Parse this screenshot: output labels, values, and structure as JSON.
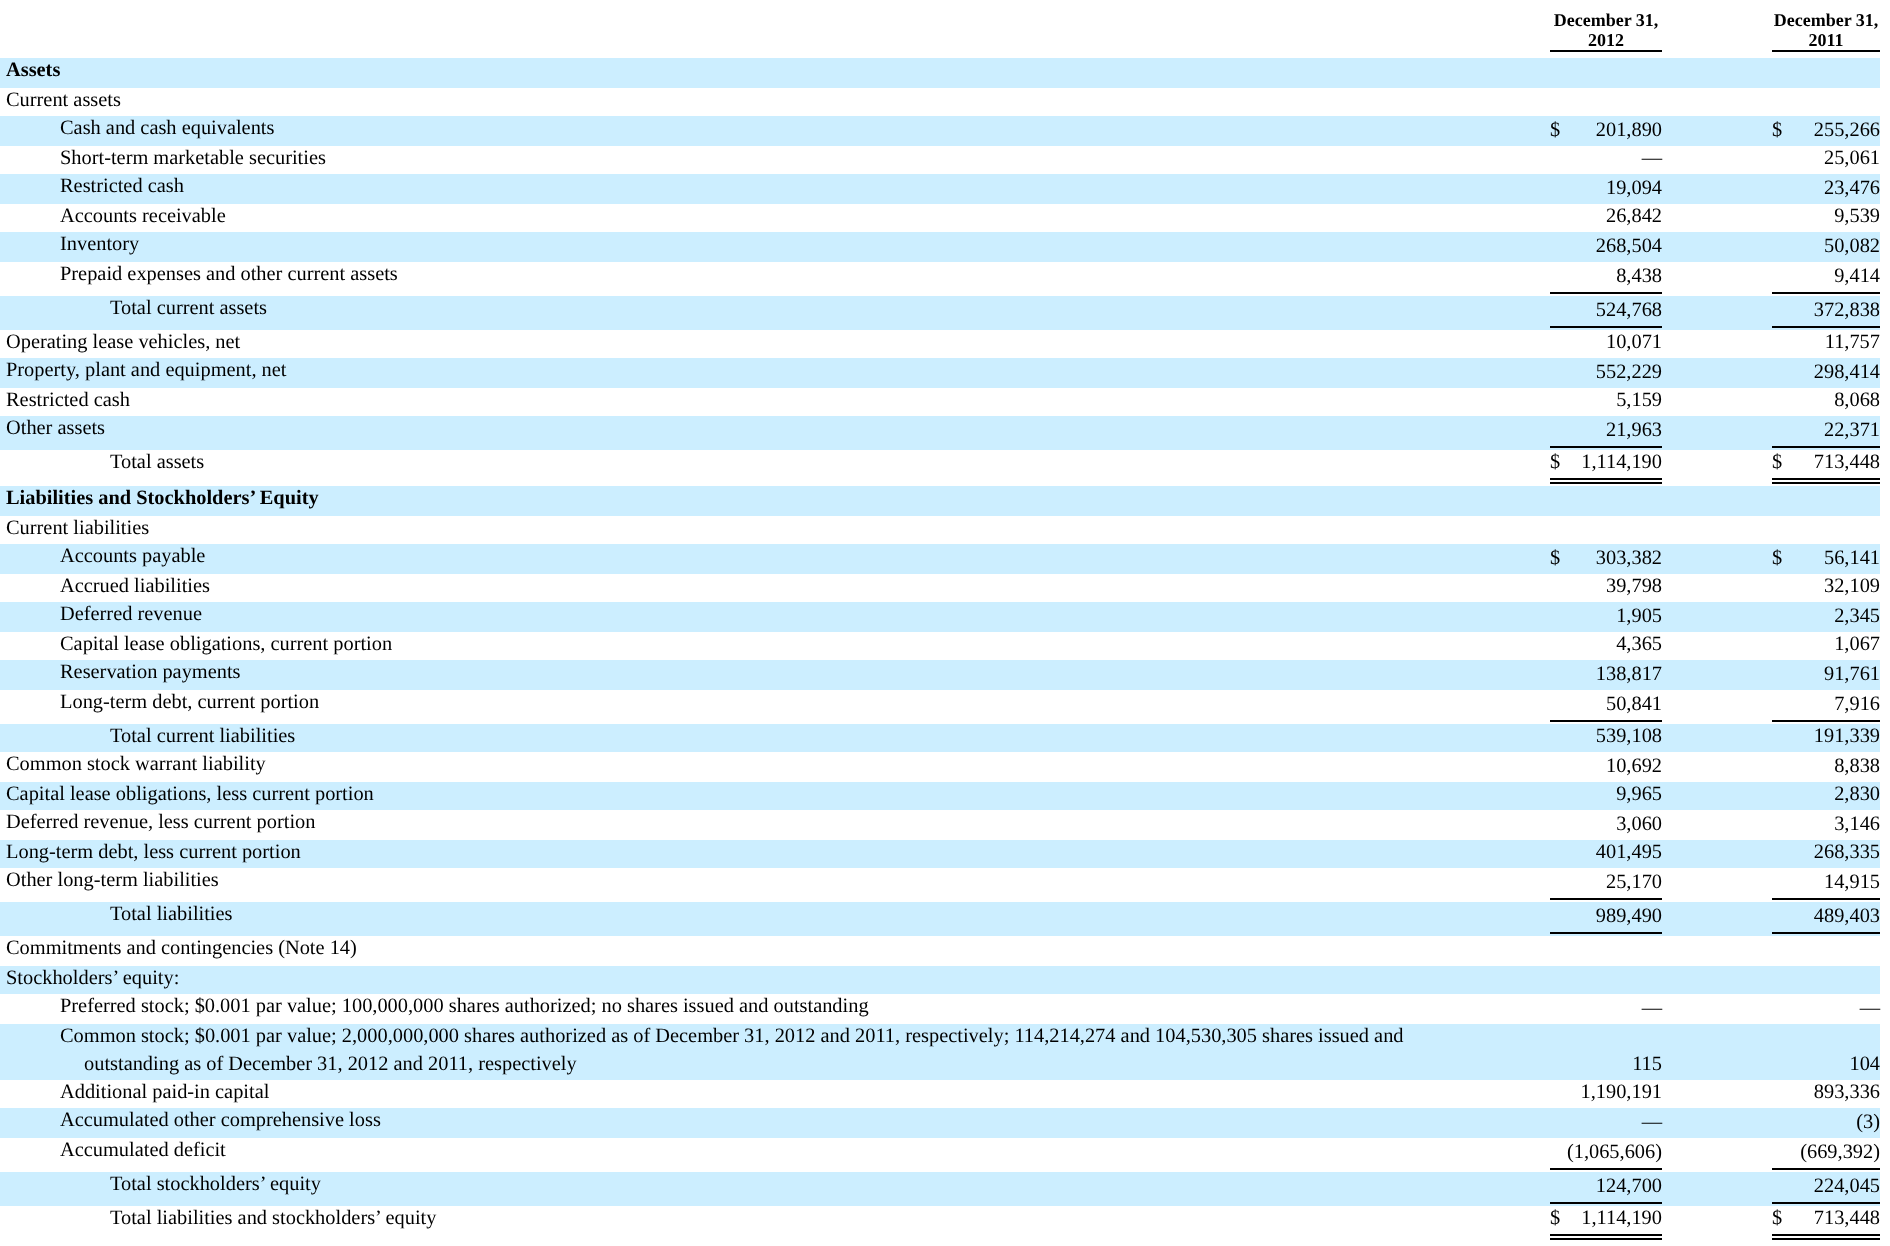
{
  "columns": [
    {
      "heading": "December 31,",
      "year": "2012"
    },
    {
      "heading": "December 31,",
      "year": "2011"
    }
  ],
  "rows": [
    {
      "kind": "section",
      "label": "Assets"
    },
    {
      "kind": "group",
      "label": "Current assets"
    },
    {
      "kind": "item",
      "label": "Cash and cash equivalents",
      "values": [
        {
          "currency": "$",
          "amount": "201,890"
        },
        {
          "currency": "$",
          "amount": "255,266"
        }
      ]
    },
    {
      "kind": "item",
      "label": "Short-term marketable securities",
      "values": [
        {
          "amount": "—"
        },
        {
          "amount": "25,061"
        }
      ]
    },
    {
      "kind": "item",
      "label": "Restricted cash",
      "values": [
        {
          "amount": "19,094"
        },
        {
          "amount": "23,476"
        }
      ]
    },
    {
      "kind": "item",
      "label": "Accounts receivable",
      "values": [
        {
          "amount": "26,842"
        },
        {
          "amount": "9,539"
        }
      ]
    },
    {
      "kind": "item",
      "label": "Inventory",
      "values": [
        {
          "amount": "268,504"
        },
        {
          "amount": "50,082"
        }
      ]
    },
    {
      "kind": "item",
      "label": "Prepaid expenses and other current assets",
      "values": [
        {
          "amount": "8,438",
          "underline": true
        },
        {
          "amount": "9,414",
          "underline": true
        }
      ]
    },
    {
      "kind": "total",
      "label": "Total current assets",
      "values": [
        {
          "amount": "524,768",
          "underline": true
        },
        {
          "amount": "372,838",
          "underline": true
        }
      ]
    },
    {
      "kind": "group",
      "label": "Operating lease vehicles, net",
      "values": [
        {
          "amount": "10,071"
        },
        {
          "amount": "11,757"
        }
      ]
    },
    {
      "kind": "group",
      "label": "Property, plant and equipment, net",
      "values": [
        {
          "amount": "552,229"
        },
        {
          "amount": "298,414"
        }
      ]
    },
    {
      "kind": "group",
      "label": "Restricted cash",
      "values": [
        {
          "amount": "5,159"
        },
        {
          "amount": "8,068"
        }
      ]
    },
    {
      "kind": "group",
      "label": "Other assets",
      "values": [
        {
          "amount": "21,963",
          "underline": true
        },
        {
          "amount": "22,371",
          "underline": true
        }
      ]
    },
    {
      "kind": "total",
      "label": "Total assets",
      "values": [
        {
          "currency": "$",
          "amount": "1,114,190",
          "double_underline": true
        },
        {
          "currency": "$",
          "amount": "713,448",
          "double_underline": true
        }
      ]
    },
    {
      "kind": "section",
      "label": "Liabilities and Stockholders’ Equity"
    },
    {
      "kind": "group",
      "label": "Current liabilities"
    },
    {
      "kind": "item",
      "label": "Accounts payable",
      "values": [
        {
          "currency": "$",
          "amount": "303,382"
        },
        {
          "currency": "$",
          "amount": "56,141"
        }
      ]
    },
    {
      "kind": "item",
      "label": "Accrued liabilities",
      "values": [
        {
          "amount": "39,798"
        },
        {
          "amount": "32,109"
        }
      ]
    },
    {
      "kind": "item",
      "label": "Deferred revenue",
      "values": [
        {
          "amount": "1,905"
        },
        {
          "amount": "2,345"
        }
      ]
    },
    {
      "kind": "item",
      "label": "Capital lease obligations, current portion",
      "values": [
        {
          "amount": "4,365"
        },
        {
          "amount": "1,067"
        }
      ]
    },
    {
      "kind": "item",
      "label": "Reservation payments",
      "values": [
        {
          "amount": "138,817"
        },
        {
          "amount": "91,761"
        }
      ]
    },
    {
      "kind": "item",
      "label": "Long-term debt, current portion",
      "values": [
        {
          "amount": "50,841",
          "underline": true
        },
        {
          "amount": "7,916",
          "underline": true
        }
      ]
    },
    {
      "kind": "total",
      "label": "Total current liabilities",
      "values": [
        {
          "amount": "539,108"
        },
        {
          "amount": "191,339"
        }
      ]
    },
    {
      "kind": "group",
      "label": "Common stock warrant liability",
      "values": [
        {
          "amount": "10,692"
        },
        {
          "amount": "8,838"
        }
      ]
    },
    {
      "kind": "group",
      "label": "Capital lease obligations, less current portion",
      "values": [
        {
          "amount": "9,965"
        },
        {
          "amount": "2,830"
        }
      ]
    },
    {
      "kind": "group",
      "label": "Deferred revenue, less current portion",
      "values": [
        {
          "amount": "3,060"
        },
        {
          "amount": "3,146"
        }
      ]
    },
    {
      "kind": "group",
      "label": "Long-term debt, less current portion",
      "values": [
        {
          "amount": "401,495"
        },
        {
          "amount": "268,335"
        }
      ]
    },
    {
      "kind": "group",
      "label": "Other long-term liabilities",
      "values": [
        {
          "amount": "25,170",
          "underline": true
        },
        {
          "amount": "14,915",
          "underline": true
        }
      ]
    },
    {
      "kind": "total",
      "label": "Total liabilities",
      "values": [
        {
          "amount": "989,490",
          "underline": true
        },
        {
          "amount": "489,403",
          "underline": true
        }
      ]
    },
    {
      "kind": "group",
      "label": "Commitments and contingencies (Note 14)"
    },
    {
      "kind": "group",
      "label": "Stockholders’ equity:"
    },
    {
      "kind": "item",
      "label": "Preferred stock; $0.001 par value; 100,000,000 shares authorized; no shares issued and outstanding",
      "values": [
        {
          "amount": "—"
        },
        {
          "amount": "—"
        }
      ]
    },
    {
      "kind": "item",
      "label": "Common stock; $0.001 par value; 2,000,000,000 shares authorized as of December 31, 2012 and 2011, respectively; 114,214,274 and 104,530,305 shares issued and outstanding as of December 31, 2012 and 2011, respectively",
      "values": [
        {
          "amount": "115"
        },
        {
          "amount": "104"
        }
      ]
    },
    {
      "kind": "item",
      "label": "Additional paid-in capital",
      "values": [
        {
          "amount": "1,190,191"
        },
        {
          "amount": "893,336"
        }
      ]
    },
    {
      "kind": "item",
      "label": "Accumulated other comprehensive loss",
      "values": [
        {
          "amount": "—"
        },
        {
          "amount": "(3)"
        }
      ]
    },
    {
      "kind": "item",
      "label": "Accumulated deficit",
      "values": [
        {
          "amount": "(1,065,606)",
          "underline": true
        },
        {
          "amount": "(669,392)",
          "underline": true
        }
      ]
    },
    {
      "kind": "total",
      "label": "Total stockholders’ equity",
      "values": [
        {
          "amount": "124,700",
          "underline": true
        },
        {
          "amount": "224,045",
          "underline": true
        }
      ]
    },
    {
      "kind": "total",
      "label": "Total liabilities and stockholders’ equity",
      "values": [
        {
          "currency": "$",
          "amount": "1,114,190",
          "double_underline": true
        },
        {
          "currency": "$",
          "amount": "713,448",
          "double_underline": true
        }
      ]
    }
  ]
}
